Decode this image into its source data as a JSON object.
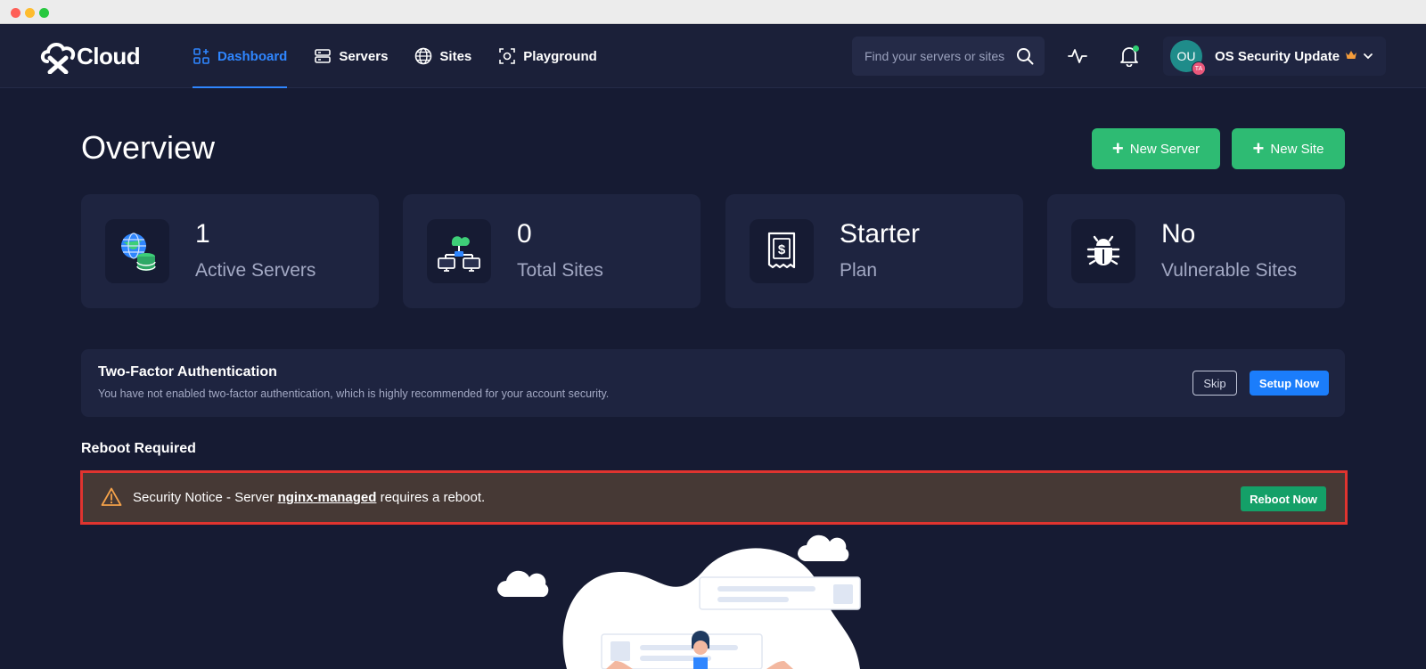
{
  "brand": {
    "logo_text": "Cloud"
  },
  "nav": {
    "items": [
      {
        "label": "Dashboard",
        "icon": "dashboard-icon",
        "active": true
      },
      {
        "label": "Servers",
        "icon": "server-icon",
        "active": false
      },
      {
        "label": "Sites",
        "icon": "globe-icon",
        "active": false
      },
      {
        "label": "Playground",
        "icon": "playground-icon",
        "active": false
      }
    ]
  },
  "search": {
    "placeholder": "Find your servers or sites"
  },
  "profile": {
    "initials": "OU",
    "badge": "TA",
    "name": "OS Security Update"
  },
  "page": {
    "title": "Overview",
    "new_server_label": "New Server",
    "new_site_label": "New Site"
  },
  "stats": [
    {
      "value": "1",
      "label": "Active Servers",
      "icon": "server-globe-icon"
    },
    {
      "value": "0",
      "label": "Total Sites",
      "icon": "network-icon"
    },
    {
      "value": "Starter",
      "label": "Plan",
      "icon": "receipt-icon"
    },
    {
      "value": "No",
      "label": "Vulnerable Sites",
      "icon": "bug-icon"
    }
  ],
  "two_factor": {
    "title": "Two-Factor Authentication",
    "description": "You have not enabled two-factor authentication, which is highly recommended for your account security.",
    "skip_label": "Skip",
    "setup_label": "Setup Now"
  },
  "reboot": {
    "section_title": "Reboot Required",
    "notice_prefix": "Security Notice - Server",
    "server_name": "nginx-managed",
    "notice_suffix": "requires a reboot.",
    "button_label": "Reboot Now"
  },
  "colors": {
    "accent_blue": "#2f86ff",
    "primary_green": "#2ebb73",
    "danger_border": "#e0342f",
    "background": "#161b33"
  }
}
